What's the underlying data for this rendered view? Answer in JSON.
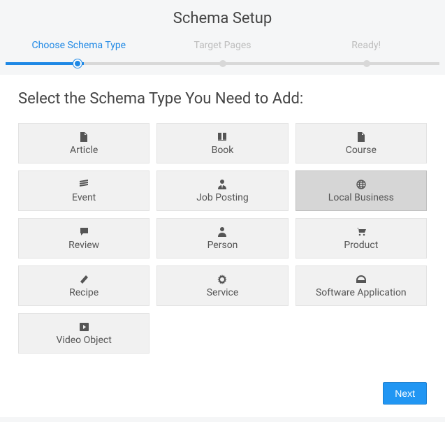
{
  "title": "Schema Setup",
  "steps": [
    {
      "label": "Choose Schema Type",
      "active": true
    },
    {
      "label": "Target Pages",
      "active": false
    },
    {
      "label": "Ready!",
      "active": false
    }
  ],
  "panel": {
    "heading": "Select the Schema Type You Need to Add:",
    "options": [
      {
        "label": "Article",
        "icon": "file-icon",
        "selected": false
      },
      {
        "label": "Book",
        "icon": "book-icon",
        "selected": false
      },
      {
        "label": "Course",
        "icon": "file-icon",
        "selected": false
      },
      {
        "label": "Event",
        "icon": "calendar-icon",
        "selected": false
      },
      {
        "label": "Job Posting",
        "icon": "user-tie-icon",
        "selected": false
      },
      {
        "label": "Local Business",
        "icon": "globe-icon",
        "selected": true
      },
      {
        "label": "Review",
        "icon": "comment-icon",
        "selected": false
      },
      {
        "label": "Person",
        "icon": "user-icon",
        "selected": false
      },
      {
        "label": "Product",
        "icon": "cart-icon",
        "selected": false
      },
      {
        "label": "Recipe",
        "icon": "carrot-icon",
        "selected": false
      },
      {
        "label": "Service",
        "icon": "gear-icon",
        "selected": false
      },
      {
        "label": "Software Application",
        "icon": "gauge-icon",
        "selected": false
      },
      {
        "label": "Video Object",
        "icon": "play-icon",
        "selected": false
      }
    ]
  },
  "buttons": {
    "next": "Next"
  }
}
